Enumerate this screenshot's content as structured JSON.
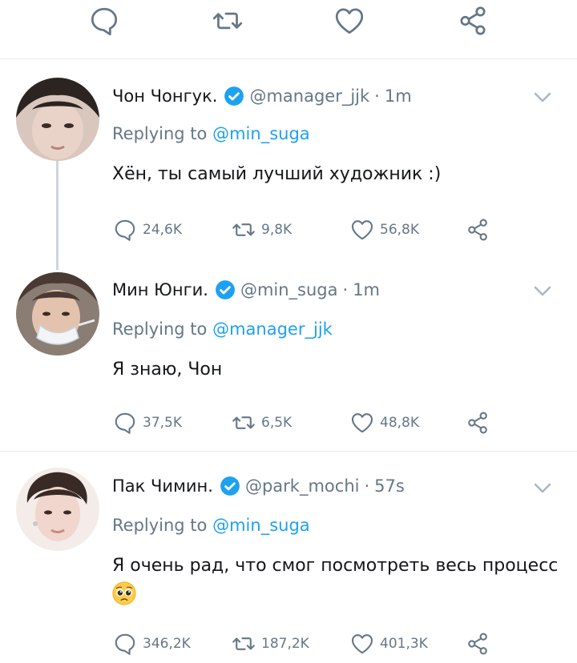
{
  "colors": {
    "accent": "#1da1f2",
    "muted": "#657786",
    "text": "#14171a",
    "divider": "#e6ecf0"
  },
  "top_actions": [
    "reply-icon",
    "retweet-icon",
    "like-icon",
    "share-icon"
  ],
  "tweets": [
    {
      "name": "Чон Чонгук.",
      "handle": "@manager_jjk",
      "separator": "·",
      "time": "1m",
      "reply_prefix": "Replying to",
      "reply_to": "@min_suga",
      "text": "Хён, ты самый лучший художник :)",
      "emoji": "",
      "replies": "24,6K",
      "retweets": "9,8K",
      "likes": "56,8K"
    },
    {
      "name": "Мин Юнги.",
      "handle": "@min_suga",
      "separator": "·",
      "time": "1m",
      "reply_prefix": "Replying to",
      "reply_to": "@manager_jjk",
      "text": "Я знаю, Чон",
      "emoji": "",
      "replies": "37,5K",
      "retweets": "6,5K",
      "likes": "48,8K"
    },
    {
      "name": "Пак Чимин.",
      "handle": "@park_mochi",
      "separator": "·",
      "time": "57s",
      "reply_prefix": "Replying to",
      "reply_to": "@min_suga",
      "text": "Я очень рад, что смог посмотреть весь процесс",
      "emoji": "pleading-face-emoji",
      "replies": "346,2K",
      "retweets": "187,2K",
      "likes": "401,3K"
    }
  ]
}
